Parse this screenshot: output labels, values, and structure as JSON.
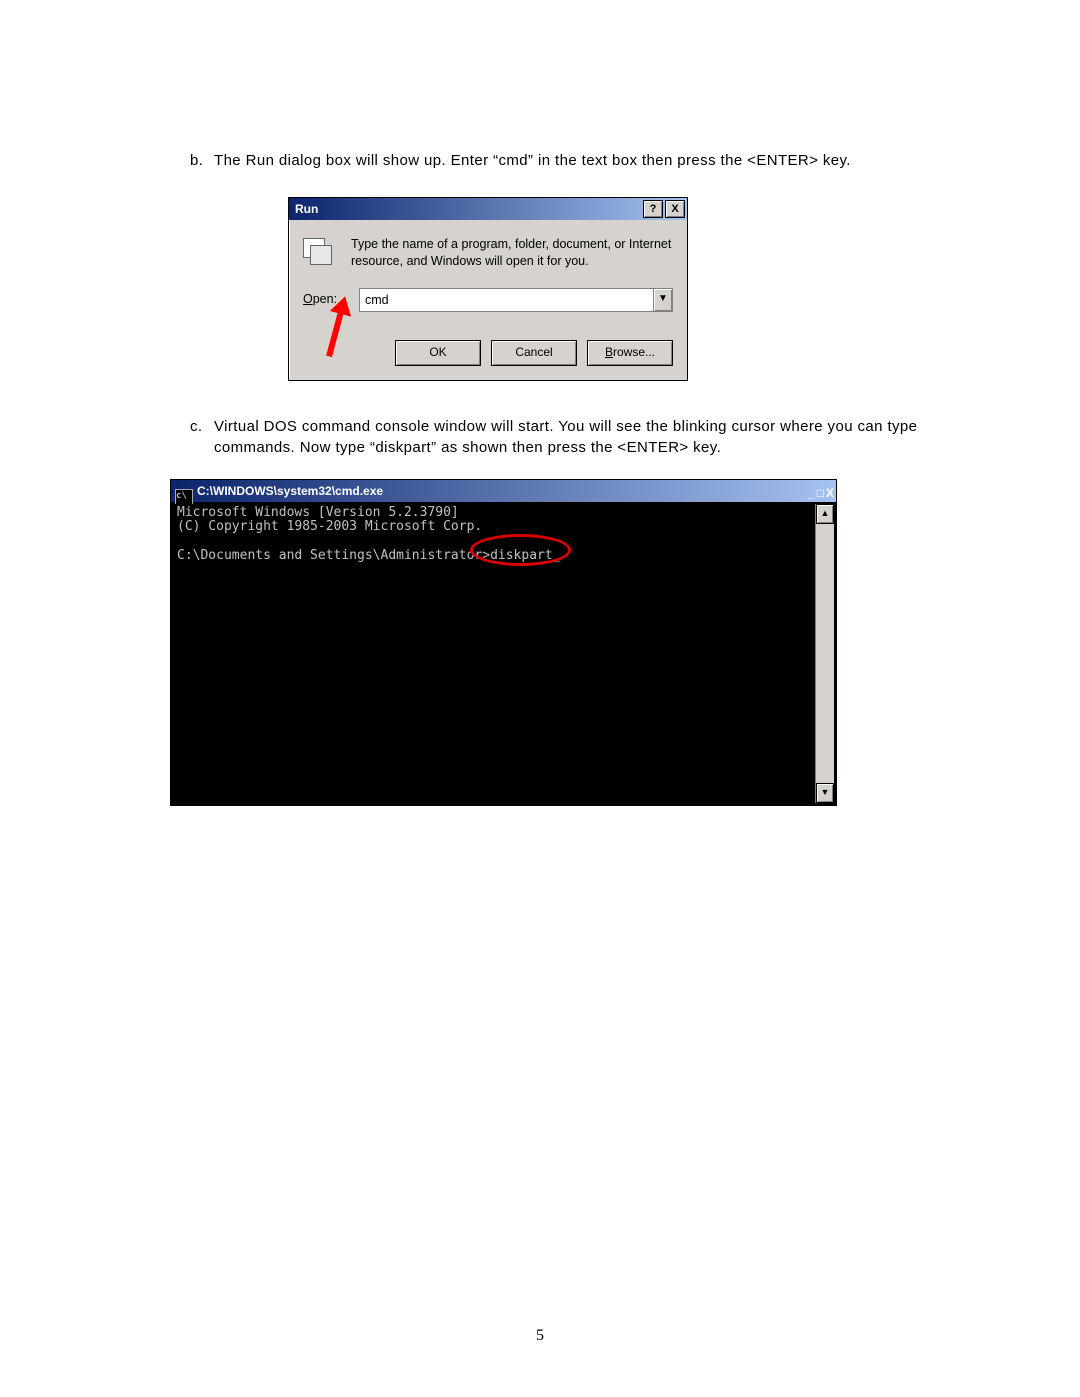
{
  "step_b": {
    "marker": "b.",
    "text": "The Run dialog box will show up. Enter “cmd” in the text box then press the <ENTER> key."
  },
  "step_c": {
    "marker": "c.",
    "text": "Virtual DOS command console window will start. You will see the blinking cursor where you can type commands. Now type “diskpart” as shown then press the <ENTER> key."
  },
  "run": {
    "title": "Run",
    "help": "?",
    "close": "X",
    "message": "Type the name of a program, folder, document, or Internet resource, and Windows will open it for you.",
    "open_label_pre": "O",
    "open_label_rest": "pen:",
    "value": "cmd",
    "ok": "OK",
    "cancel": "Cancel",
    "browse_pre": "B",
    "browse_rest": "rowse..."
  },
  "cmd": {
    "title_prefix": "C:\\WINDOWS\\system32\\",
    "title_file": "cmd.exe",
    "line1": "Microsoft Windows [Version 5.2.3790]",
    "line2": "(C) Copyright 1985-2003 Microsoft Corp.",
    "prompt": "C:\\Documents and Settings\\Administrator>diskpart_",
    "minimize": "_",
    "maximize": "□",
    "close": "X",
    "up": "▲",
    "down": "▼"
  },
  "page_number": "5"
}
